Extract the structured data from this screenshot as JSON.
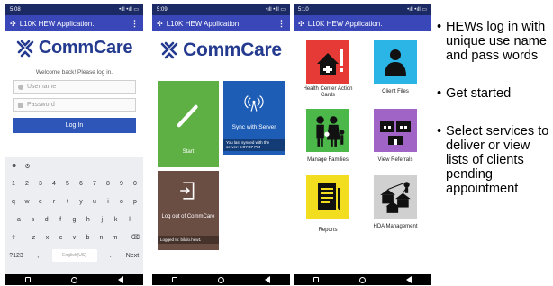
{
  "screen1": {
    "status": {
      "time": "5:08",
      "right": "•ıll •ıll ▭"
    },
    "app_title": "L10K HEW Application.",
    "logo_text": "CommCare",
    "welcome": "Welcome back! Please log in.",
    "username_placeholder": "Username",
    "password_placeholder": "Password",
    "login_label": "Log In",
    "keyboard": {
      "row1": [
        "1",
        "2",
        "3",
        "4",
        "5",
        "6",
        "7",
        "8",
        "9",
        "0"
      ],
      "row2": [
        "q",
        "w",
        "e",
        "r",
        "t",
        "y",
        "u",
        "i",
        "o",
        "p"
      ],
      "row3": [
        "a",
        "s",
        "d",
        "f",
        "g",
        "h",
        "j",
        "k",
        "l"
      ],
      "row4": [
        "z",
        "x",
        "c",
        "v",
        "b",
        "n",
        "m"
      ],
      "bottom_left": "?123",
      "comma": ",",
      "space": "English(US)",
      "period": ".",
      "next": "Next"
    }
  },
  "screen2": {
    "status": {
      "time": "5:09",
      "right": "•ıll •ıll ▭"
    },
    "app_title": "L10K HEW Application.",
    "logo_text": "CommCare",
    "start_label": "Start",
    "sync_label": "Sync with Server",
    "sync_sub": "You last synced with the server: 5:07:37 PM",
    "logout_label": "Log out of CommCare",
    "logout_sub": "Logged In: bilalo.hew1"
  },
  "screen3": {
    "status": {
      "time": "5:10",
      "right": "•ıll •ıll ▭"
    },
    "app_title": "L10K HEW Application.",
    "items": [
      {
        "label": "Health Center Action Cards",
        "icon": "health-center-icon"
      },
      {
        "label": "Client Files",
        "icon": "person-icon"
      },
      {
        "label": "Manage Families",
        "icon": "family-icon"
      },
      {
        "label": "View Referrals",
        "icon": "referral-icon"
      },
      {
        "label": "Reports",
        "icon": "report-icon"
      },
      {
        "label": "HDA Management",
        "icon": "hda-icon"
      }
    ]
  },
  "notes": [
    "HEWs log in with unique use name and pass words",
    "Get started",
    "Select services to deliver or view lists of clients pending appointment"
  ]
}
